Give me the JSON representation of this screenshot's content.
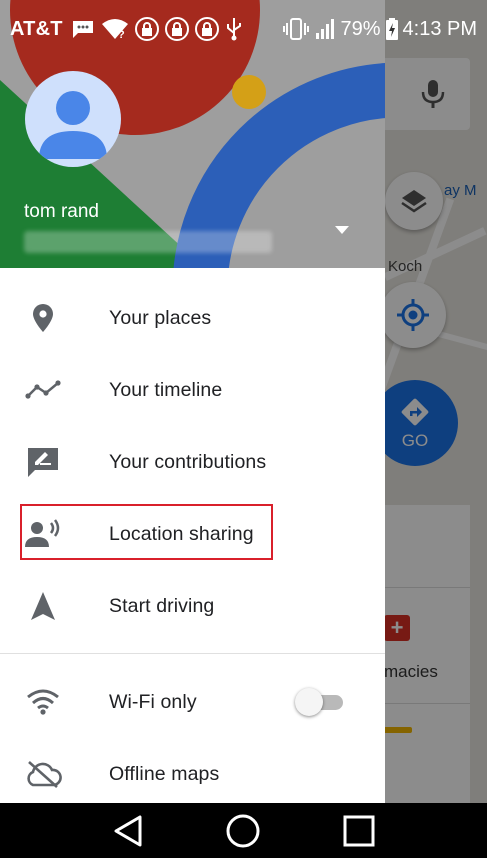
{
  "status_bar": {
    "carrier": "AT&T",
    "battery": "79%",
    "time": "4:13 PM"
  },
  "account": {
    "name": "tom rand"
  },
  "menu": {
    "items": [
      {
        "label": "Your places",
        "icon": "place-pin-icon"
      },
      {
        "label": "Your timeline",
        "icon": "timeline-icon"
      },
      {
        "label": "Your contributions",
        "icon": "contributions-icon"
      },
      {
        "label": "Location sharing",
        "icon": "location-sharing-icon"
      },
      {
        "label": "Start driving",
        "icon": "navigation-arrow-icon"
      },
      {
        "label": "Wi-Fi only",
        "icon": "wifi-icon"
      },
      {
        "label": "Offline maps",
        "icon": "cloud-off-icon"
      }
    ],
    "wifi_only_enabled": false
  },
  "map": {
    "go_label": "GO",
    "partial_label_1": "Koch",
    "partial_label_2": "ay M",
    "partial_label_3": "macies"
  },
  "colors": {
    "accent_blue": "#1a73e8",
    "highlight_red": "#d9202b",
    "header_red": "#a52a1e",
    "header_green": "#1e7e34",
    "header_blue": "#2c5fb8",
    "header_yellow": "#d4a017"
  }
}
